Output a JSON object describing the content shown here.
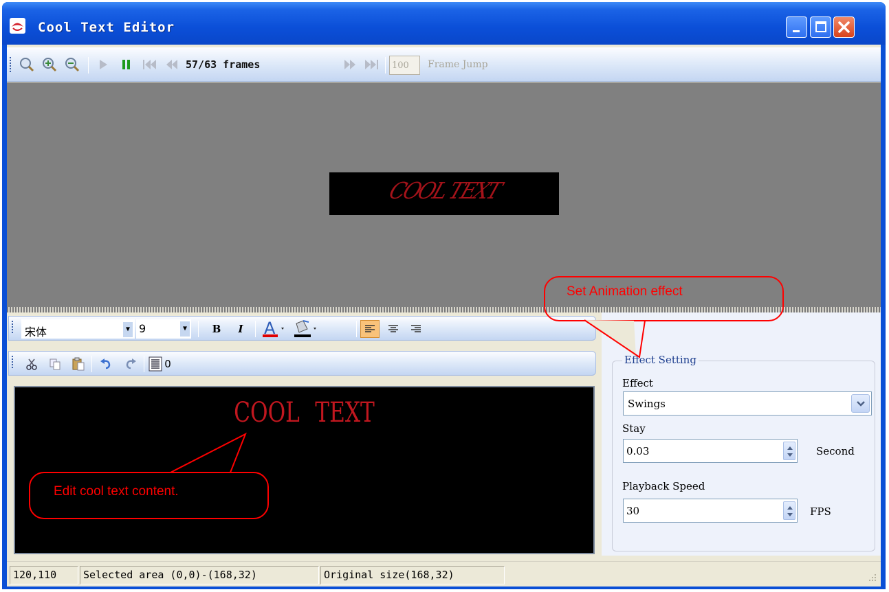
{
  "window": {
    "title": "Cool Text Editor"
  },
  "top_toolbar": {
    "buttons": [
      "zoom-fit",
      "zoom-in",
      "zoom-out",
      "play",
      "pause",
      "first-frame",
      "prev-frame",
      "next-frame",
      "last-frame"
    ],
    "frames_label": "57/63 frames",
    "frame_jump_value": "100",
    "frame_jump_label": "Frame Jump"
  },
  "preview": {
    "text": "COOL TEXT",
    "text_color": "#c1171f"
  },
  "format_toolbar": {
    "font_name": "宋体",
    "font_size": "9",
    "bold_label": "B",
    "italic_label": "I",
    "font_color_label": "A"
  },
  "edit_toolbar": {
    "spacing_value": "0"
  },
  "editor": {
    "content": "COOL  TEXT"
  },
  "effect_setting": {
    "group_title": "Effect Setting",
    "effect_label": "Effect",
    "effect_value": "Swings",
    "stay_label": "Stay",
    "stay_value": "0.03",
    "stay_unit": "Second",
    "speed_label": "Playback Speed",
    "speed_value": "30",
    "speed_unit": "FPS"
  },
  "status_bar": {
    "cursor": "120,110",
    "selected_area": "Selected area (0,0)-(168,32)",
    "original_size": "Original size(168,32)"
  },
  "callouts": {
    "animation": "Set Animation effect",
    "edit": "Edit cool text content."
  },
  "colors": {
    "title_bar": "#0a4fd6",
    "annotation": "#ff0000",
    "text_red": "#c1171f"
  }
}
